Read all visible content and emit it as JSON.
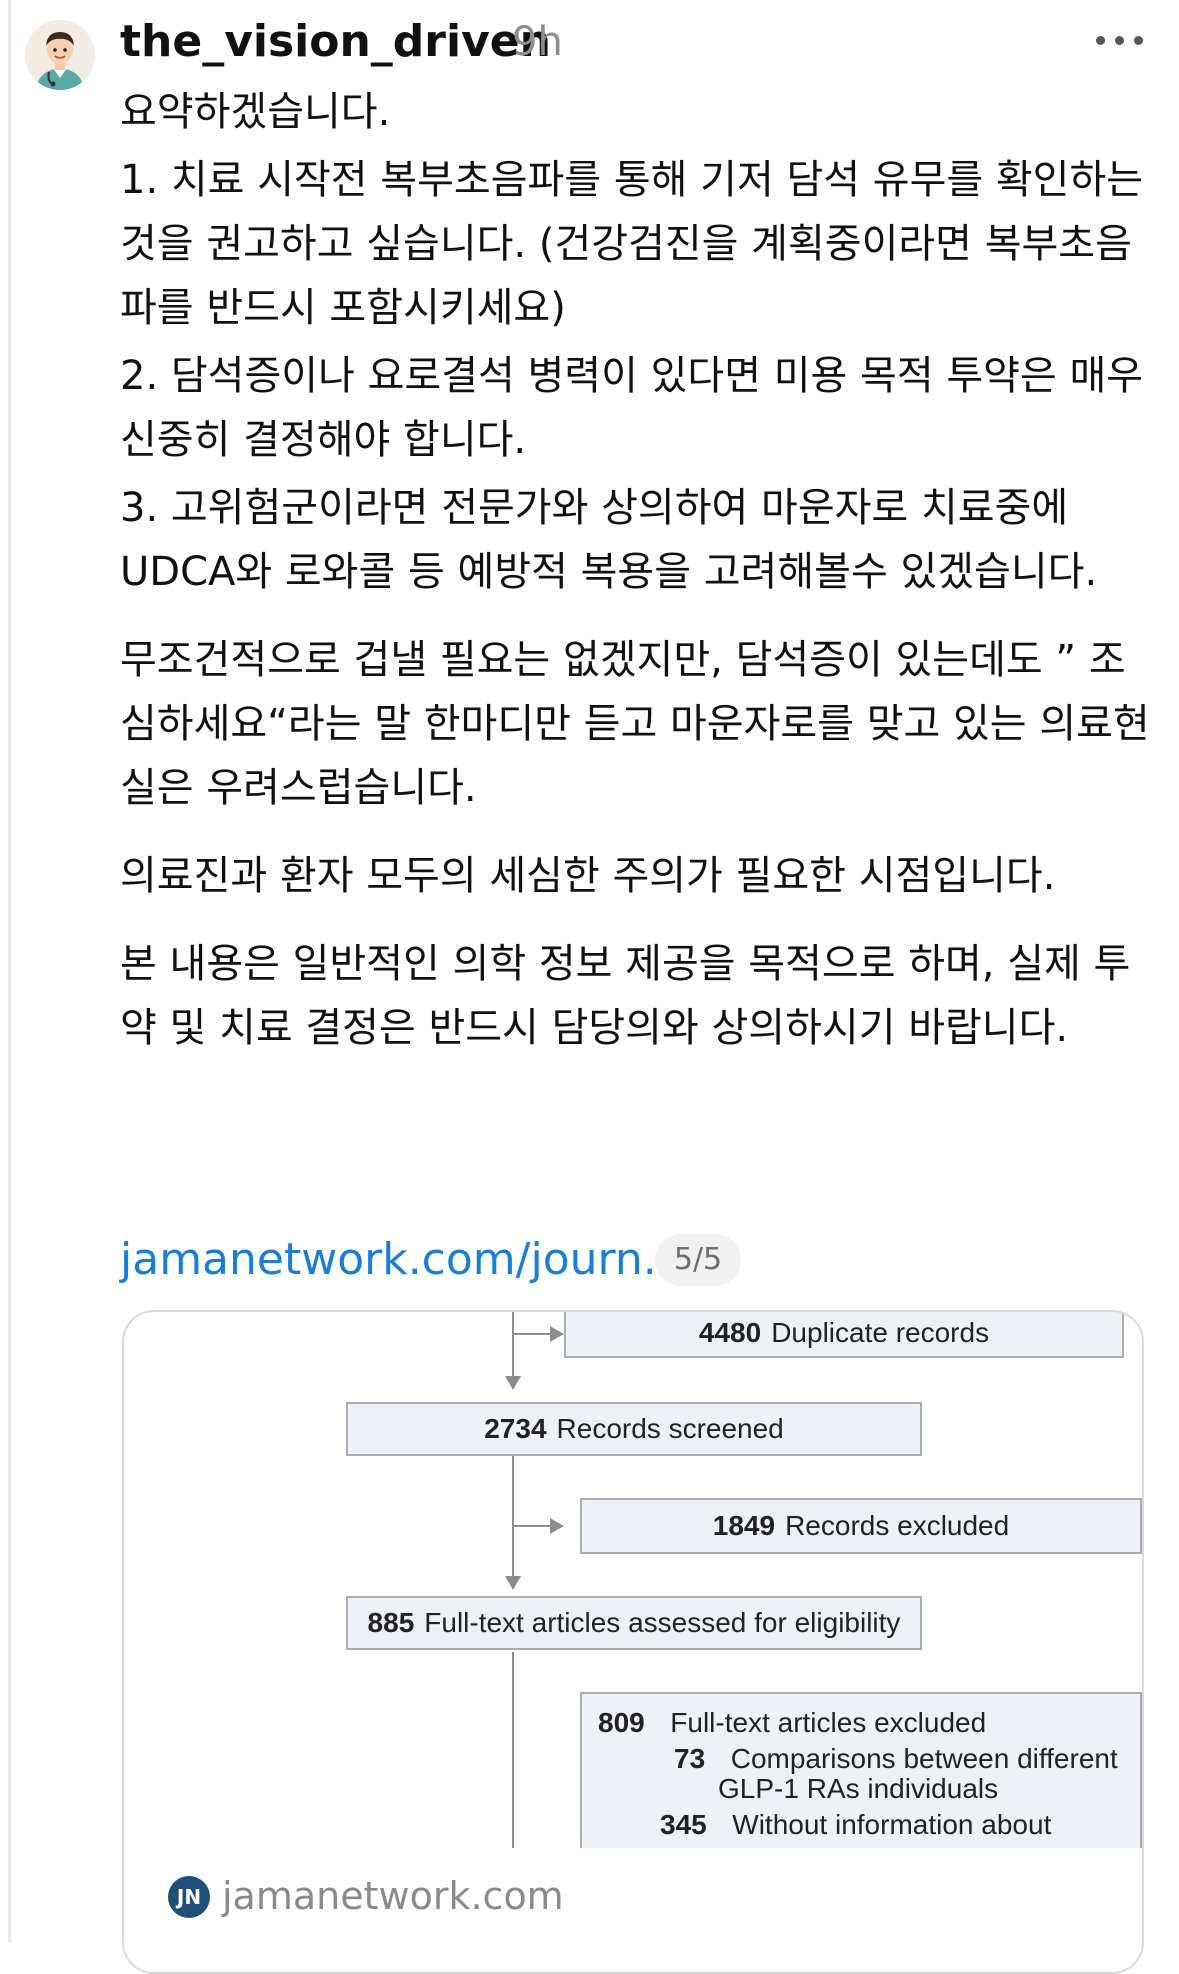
{
  "post": {
    "username": "the_vision_driven",
    "time": "9h",
    "paragraphs": [
      "요약하겠습니다.",
      "1. 치료 시작전 복부초음파를 통해 기저 담석 유무를 확인하는 것을 권고하고 싶습니다. (건강검진을 계획중이라면 복부초음파를 반드시 포함시키세요)",
      "2. 담석증이나 요로결석 병력이 있다면 미용 목적 투약은 매우 신중히 결정해야 합니다.",
      "3. 고위험군이라면 전문가와 상의하여 마운자로 치료중에 UDCA와 로와콜 등 예방적 복용을 고려해볼수 있겠습니다.",
      "무조건적으로 겁낼 필요는 없겠지만, 담석증이 있는데도 ” 조심하세요“라는 말 한마디만 듣고 마운자로를 맞고 있는 의료현실은  우려스럽습니다.",
      "의료진과 환자 모두의 세심한 주의가 필요한 시점입니다.",
      "본 내용은 일반적인 의학 정보 제공을 목적으로 하며, 실제 투약 및 치료 결정은 반드시 담당의와 상의하시기 바랍니다."
    ]
  },
  "link": {
    "text": "jamanetwork.com/journ...",
    "page_count": "5/5"
  },
  "card": {
    "flow": {
      "duplicate": {
        "num": "4480",
        "label": "Duplicate records"
      },
      "screened": {
        "num": "2734",
        "label": "Records screened"
      },
      "excluded": {
        "num": "1849",
        "label": "Records excluded"
      },
      "assessed": {
        "num": "885",
        "label": "Full-text articles assessed for eligibility"
      },
      "fulltext_excluded": {
        "num": "809",
        "label": "Full-text articles excluded",
        "reason1_num": "73",
        "reason1_line1": "Comparisons between different",
        "reason1_line2": "GLP-1 RAs individuals",
        "reason2_num": "345",
        "reason2_line1": "Without information about"
      }
    },
    "footer": {
      "logo": "JN",
      "domain": "jamanetwork.com"
    }
  },
  "colors": {
    "link": "#1a7fd4",
    "muted": "#8e8e8e",
    "box_fill": "#eef1f5",
    "logo": "#1f4e79"
  }
}
